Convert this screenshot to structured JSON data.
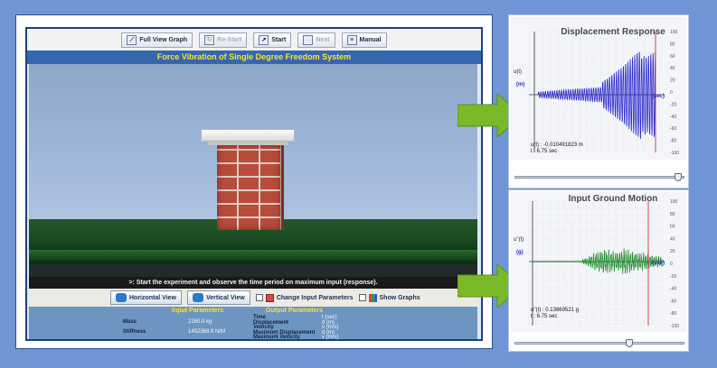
{
  "toolbar": {
    "full_view_graph": "Full View Graph",
    "re_start": "Re-Start",
    "start": "Start",
    "next": "Next",
    "manual": "Manual"
  },
  "simulation": {
    "title": "Force Vibration of Single Degree Freedom System",
    "message": ">: Start the experiment and observe the time period on maximum input (response)."
  },
  "view_bar": {
    "horizontal_view": "Horizontal View",
    "vertical_view": "Vertical View",
    "change_input_parameters": "Change Input Parameters",
    "show_graphs": "Show Graphs"
  },
  "input_parameters": {
    "heading": "Input Parameters",
    "rows": [
      {
        "label": "Mass",
        "value": "2160.0 kg"
      },
      {
        "label": "Stiffness",
        "value": "1452368.9 N/M"
      }
    ]
  },
  "output_parameters": {
    "heading": "Output Parameters",
    "rows": [
      {
        "label": "Time",
        "value": "t (sec)"
      },
      {
        "label": "Displacement",
        "value": "d (m)"
      },
      {
        "label": "Velocity",
        "value": "v (m/s)"
      },
      {
        "label": "Maximum Displacement",
        "value": "d (m)"
      },
      {
        "label": "Maximum Velocity",
        "value": "v (m/s)"
      }
    ]
  },
  "displacement_graph": {
    "title": "Displacement Response",
    "y_label": "u(t)",
    "unit_label": "(m)",
    "x_label": "(sec)",
    "readout_value": "u(t) : -0.010491823 m",
    "readout_time": "t : 6.75 sec",
    "ticks": [
      "100",
      "80",
      "60",
      "40",
      "20",
      "0",
      "-20",
      "-40",
      "-60",
      "-80",
      "-100"
    ],
    "slider_position": 0.98,
    "line_color": "#2a2acb"
  },
  "ground_graph": {
    "title": "Input Ground Motion",
    "y_label": "u''(t)",
    "unit_label": "(g)",
    "x_label": "(sec)",
    "readout_value": "u''(t) : 0.13869521 g",
    "readout_time": "t : 6.75 sec",
    "ticks": [
      "100",
      "80",
      "60",
      "40",
      "20",
      "0",
      "-20",
      "-40",
      "-60",
      "-80",
      "-100"
    ],
    "slider_position": 0.68,
    "line_color": "#1f8a2a"
  },
  "colors": {
    "background": "#6f95d6",
    "title_bar": "#3667ad",
    "title_text": "#ffe226",
    "arrow": "#7ab928"
  }
}
